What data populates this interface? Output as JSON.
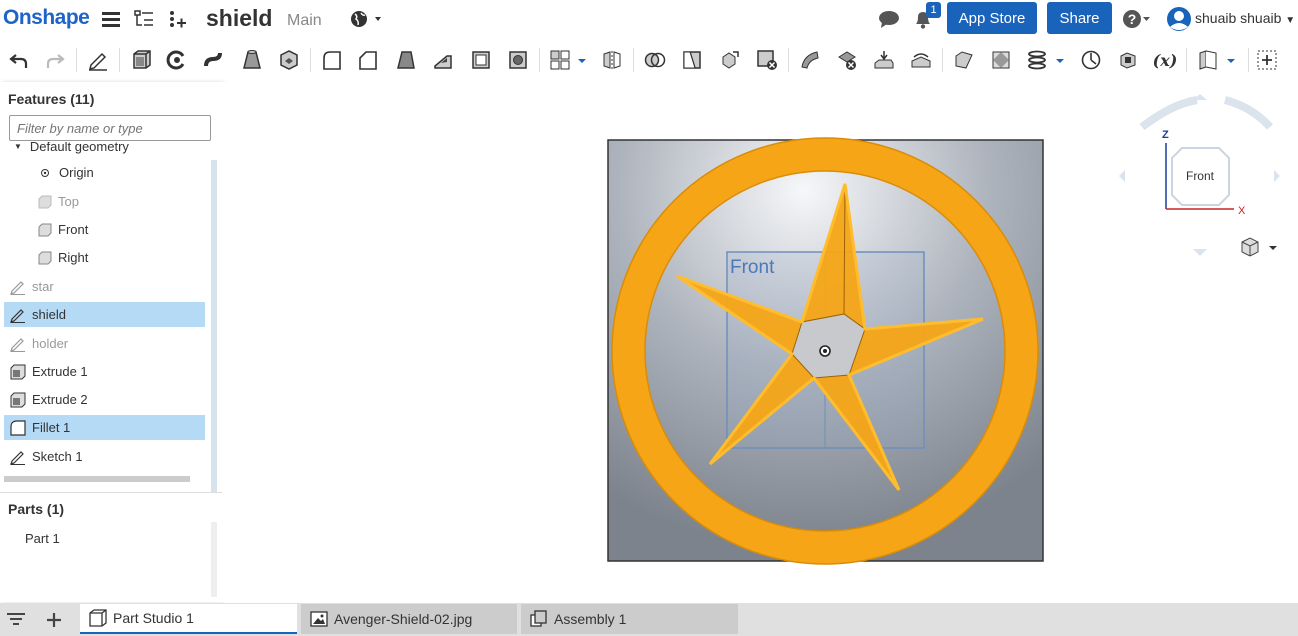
{
  "app": {
    "logo": "Onshape",
    "doc_title": "shield",
    "branch": "Main"
  },
  "header": {
    "notification_count": "1",
    "app_store_label": "App Store",
    "share_label": "Share",
    "user_name": "shuaib shuaib"
  },
  "features_panel": {
    "title": "Features (11)",
    "filter_placeholder": "Filter by name or type",
    "items": [
      {
        "label": "Default geometry",
        "icon": "caret-down-icon"
      },
      {
        "label": "Origin",
        "icon": "origin-icon"
      },
      {
        "label": "Top",
        "icon": "plane-icon"
      },
      {
        "label": "Front",
        "icon": "plane-icon"
      },
      {
        "label": "Right",
        "icon": "plane-icon"
      },
      {
        "label": "star",
        "icon": "sketch-icon"
      },
      {
        "label": "shield",
        "icon": "sketch-icon"
      },
      {
        "label": "holder",
        "icon": "sketch-icon"
      },
      {
        "label": "Extrude 1",
        "icon": "extrude-icon"
      },
      {
        "label": "Extrude 2",
        "icon": "extrude-icon"
      },
      {
        "label": "Fillet 1",
        "icon": "fillet-icon"
      },
      {
        "label": "Sketch 1",
        "icon": "sketch-icon"
      }
    ]
  },
  "parts_panel": {
    "title": "Parts (1)",
    "items": [
      "Part 1"
    ]
  },
  "viewport": {
    "plane_label": "Front",
    "view_cube_label": "Front",
    "axis_z": "Z",
    "axis_x": "X"
  },
  "tabs": [
    {
      "label": "Part Studio 1",
      "icon": "part-studio-icon"
    },
    {
      "label": "Avenger-Shield-02.jpg",
      "icon": "image-icon"
    },
    {
      "label": "Assembly 1",
      "icon": "assembly-icon"
    }
  ],
  "colors": {
    "brand": "#1e64c8",
    "button": "#1a63ba",
    "selection": "#b5daf5",
    "part": "#f5a516"
  }
}
